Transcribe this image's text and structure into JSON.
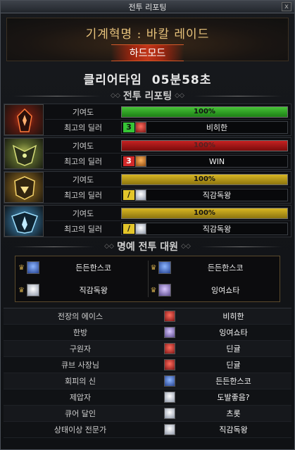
{
  "window": {
    "title": "전투 리포팅",
    "close": "x"
  },
  "header": {
    "raid_name": "기계혁명 : 바칼 레이드",
    "mode": "하드모드"
  },
  "clear": {
    "label": "클리어타임",
    "time": "05분58초"
  },
  "report_title": "전투 리포팅",
  "bosses": [
    {
      "contrib_label": "기여도",
      "contrib_value": "100%",
      "contrib_fraction": 1.0,
      "bar_color": "#3fb52f",
      "dealer_label": "최고의 딜러",
      "class_number": "3",
      "dealer_name": "비히한"
    },
    {
      "contrib_label": "기여도",
      "contrib_value": "100%",
      "contrib_fraction": 1.0,
      "bar_color": "#b81c1c",
      "dealer_label": "최고의 딜러",
      "class_number": "3",
      "dealer_name": "WIN"
    },
    {
      "contrib_label": "기여도",
      "contrib_value": "100%",
      "contrib_fraction": 1.0,
      "bar_color": "#c9a81f",
      "dealer_label": "최고의 딜러",
      "class_number": "/",
      "dealer_name": "직감독왕"
    },
    {
      "contrib_label": "기여도",
      "contrib_value": "100%",
      "contrib_fraction": 1.0,
      "bar_color": "#c9a81f",
      "dealer_label": "최고의 딜러",
      "class_number": "/",
      "dealer_name": "직감독왕"
    }
  ],
  "honor": {
    "title": "명예 전투 대원",
    "members": [
      {
        "name": "든든한스코"
      },
      {
        "name": "든든한스코"
      },
      {
        "name": "직감독왕"
      },
      {
        "name": "잉여쇼타"
      }
    ]
  },
  "awards": [
    {
      "title": "전장의 에이스",
      "name": "비히한"
    },
    {
      "title": "한방",
      "name": "잉여쇼타"
    },
    {
      "title": "구원자",
      "name": "딘귤"
    },
    {
      "title": "큐브 사장님",
      "name": "딘귤"
    },
    {
      "title": "회피의 신",
      "name": "든든한스코"
    },
    {
      "title": "제압자",
      "name": "도발좋음?"
    },
    {
      "title": "큐어 달인",
      "name": "츠롯"
    },
    {
      "title": "상태이상 전문가",
      "name": "직감독왕"
    }
  ]
}
